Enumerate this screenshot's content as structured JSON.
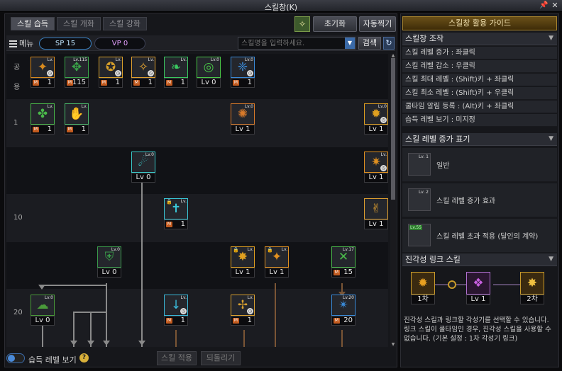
{
  "window": {
    "title": "스킬창(K)"
  },
  "tabs": [
    "스킬 습득",
    "스킬 개화",
    "스킬 강화"
  ],
  "top_buttons": {
    "reset": "초기화",
    "auto": "자동찍기"
  },
  "toolbar": {
    "menu": "메뉴",
    "sp": "SP 15",
    "vp": "VP 0",
    "search_placeholder": "스킬명을 입력하세요.",
    "search_button": "검색"
  },
  "tree": {
    "row_labels": {
      "common_1": "공",
      "common_2": "용",
      "lv1": "1",
      "lv10": "10",
      "lv20": "20"
    },
    "skills": {
      "c1": {
        "cap": "1",
        "lvtag": "Lv.",
        "m": "M",
        "glyph": "✦",
        "color": "#d88a1e"
      },
      "c2": {
        "cap": "115",
        "lvtag": "Lv.115",
        "m": "M",
        "glyph": "✥",
        "color": "#3aa84a"
      },
      "c3": {
        "cap": "1",
        "lvtag": "Lv.",
        "m": "M",
        "glyph": "✪",
        "color": "#d8a02a"
      },
      "c4": {
        "cap": "1",
        "lvtag": "Lv.",
        "m": "M",
        "glyph": "✧",
        "color": "#e0a030"
      },
      "c5": {
        "cap": "1",
        "lvtag": "Lv.",
        "m": "M",
        "glyph": "❧",
        "color": "#3ac860"
      },
      "c6": {
        "cap": "Lv 0",
        "lvtag": "Lv.0",
        "glyph": "◎",
        "color": "#4ac848"
      },
      "c7": {
        "cap": "1",
        "lvtag": "Lv.0",
        "m": "M",
        "glyph": "❈",
        "color": "#3a8ad8"
      },
      "r1a": {
        "cap": "1",
        "lvtag": "Lv.",
        "m": "M",
        "glyph": "✤",
        "color": "#4ab84a"
      },
      "r1b": {
        "cap": "1",
        "lvtag": "Lv.",
        "m": "M",
        "glyph": "✋",
        "color": "#4ab86a"
      },
      "r1c": {
        "cap": "Lv 1",
        "lvtag": "Lv.0",
        "glyph": "✺",
        "color": "#d87a2a"
      },
      "r1d": {
        "cap": "Lv 1",
        "lvtag": "Lv.0",
        "glyph": "✹",
        "color": "#e0a020"
      },
      "r2a": {
        "cap": "Lv 0",
        "lvtag": "Lv.0",
        "glyph": "☄",
        "color": "#3ac8c8"
      },
      "r2b": {
        "cap": "Lv 1",
        "lvtag": "Lv.",
        "glyph": "✷",
        "color": "#e09020"
      },
      "r3a": {
        "cap": "1",
        "lvtag": "Lv.",
        "m": "M",
        "glyph": "✝",
        "color": "#3ac8d8"
      },
      "r3b": {
        "cap": "Lv 1",
        "lvtag": "",
        "glyph": "✌",
        "color": "#e0a030"
      },
      "r4a": {
        "cap": "Lv 0",
        "lvtag": "Lv.0",
        "glyph": "⛨",
        "color": "#3a9a4a"
      },
      "r4b": {
        "cap": "Lv 1",
        "lvtag": "Lv.",
        "glyph": "✸",
        "color": "#e0a020"
      },
      "r4c": {
        "cap": "Lv 1",
        "lvtag": "Lv.",
        "glyph": "✦",
        "color": "#e09020"
      },
      "r4d": {
        "cap": "15",
        "lvtag": "Lv.17",
        "m": "M",
        "glyph": "✕",
        "color": "#4ab84a"
      },
      "r5a": {
        "cap": "Lv 0",
        "lvtag": "Lv.0",
        "glyph": "☁",
        "color": "#4a9a3a"
      },
      "r5b": {
        "cap": "1",
        "lvtag": "Lv.",
        "m": "M",
        "glyph": "↓",
        "color": "#3ab8d8"
      },
      "r5c": {
        "cap": "1",
        "lvtag": "Lv.",
        "m": "M",
        "glyph": "✢",
        "color": "#d8a030"
      },
      "r5d": {
        "cap": "20",
        "lvtag": "Lv.20",
        "m": "M",
        "glyph": "✴",
        "color": "#3a8ad8"
      }
    }
  },
  "bottom": {
    "toggle_label": "습득 레벨 보기",
    "help": "?",
    "apply": "스킬 적용",
    "revert": "되돌리기"
  },
  "guide": {
    "button": "스킬창 활용 가이드",
    "controls_title": "스킬창 조작",
    "controls": [
      "스킬 레벨 증가 : 좌클릭",
      "스킬 레벨 감소 : 우클릭",
      "스킬 최대 레벨 : (Shift)키 + 좌클릭",
      "스킬 최소 레벨 : (Shift)키 + 우클릭",
      "쿨타임 알림 등록 : (Alt)키 + 좌클릭",
      "습득 레벨 보기 : 미지정"
    ],
    "legend_title": "스킬 레벨 증가 표기",
    "legend": [
      {
        "tag": "Lv. 1",
        "label": "일반"
      },
      {
        "tag": "Lv. 2",
        "label": "스킬 레벨 증가 효과"
      },
      {
        "tag": "Lv.55",
        "label": "스킬 레벨 초과 적용 (달인의 계약)"
      }
    ],
    "link_title": "진각성 링크 스킬",
    "link_slots": [
      "1차",
      "Lv 1",
      "2차"
    ],
    "link_desc": "진각성 스킬과 링크할 각성기를 선택할 수 있습니다. 링크 스킬이 쿨타임인 경우, 진각성 스킬을 사용할 수 없습니다. (기본 설정 : 1차 각성기 링크)"
  }
}
